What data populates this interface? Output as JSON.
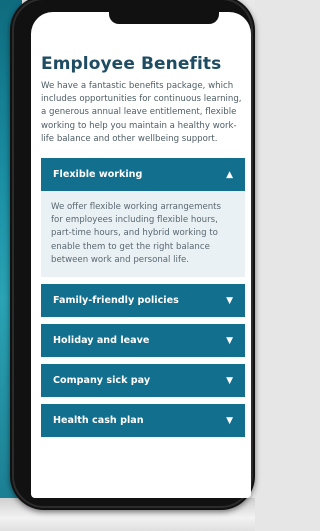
{
  "page": {
    "title": "Employee Benefits",
    "intro": "We have a fantastic benefits package, which includes opportunities for continuous learning, a generous annual leave entitlement, flexible working to help you maintain a healthy work-life balance and other wellbeing support."
  },
  "accordion": {
    "items": [
      {
        "label": "Flexible working",
        "expanded": true,
        "icon": "▲",
        "body": "We offer flexible working arrangements for employees including flexible hours, part-time hours, and hybrid working to enable them to get the right balance between work and personal life."
      },
      {
        "label": "Family-friendly policies",
        "expanded": false,
        "icon": "▼"
      },
      {
        "label": "Holiday and leave",
        "expanded": false,
        "icon": "▼"
      },
      {
        "label": "Company sick pay",
        "expanded": false,
        "icon": "▼"
      },
      {
        "label": "Health cash plan",
        "expanded": false,
        "icon": "▼"
      }
    ]
  },
  "colors": {
    "accent": "#136f8e",
    "title": "#1e4d63",
    "panel": "#e9f1f4"
  }
}
